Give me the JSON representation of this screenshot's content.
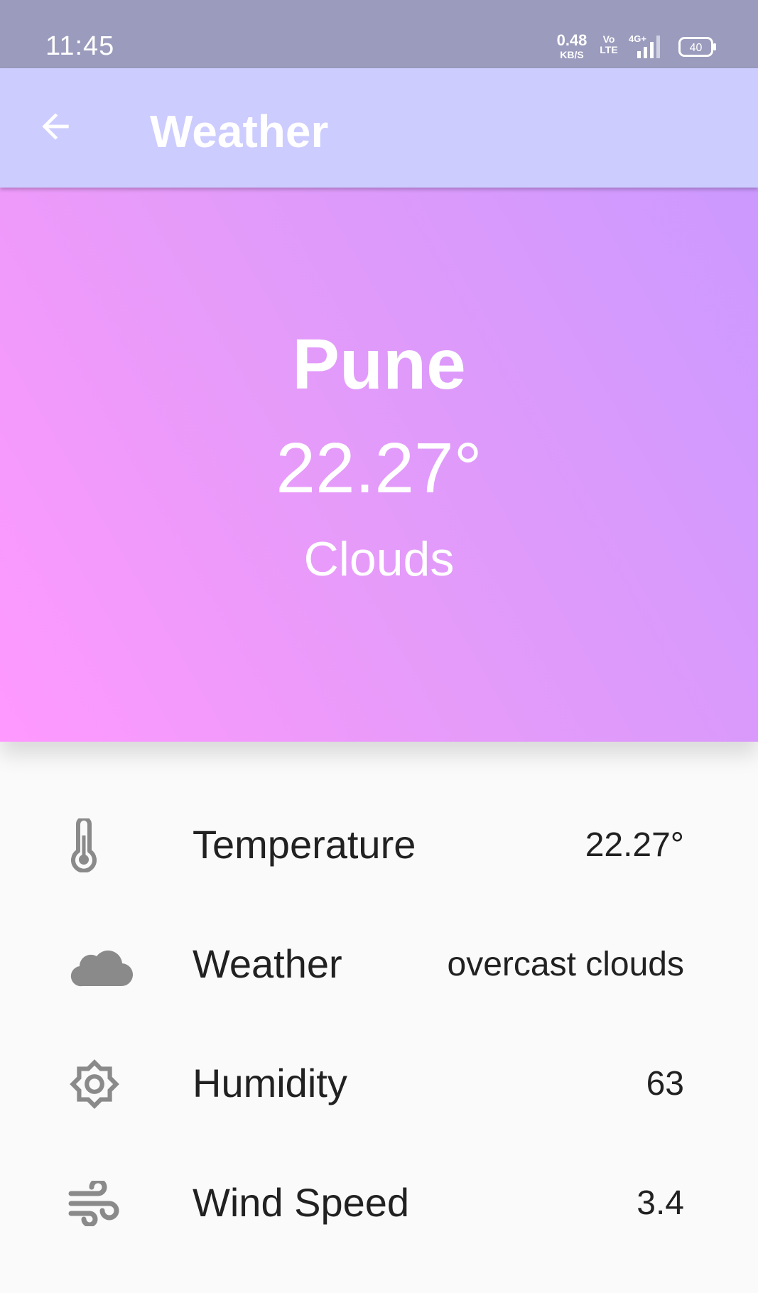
{
  "status_bar": {
    "time": "11:45",
    "net_speed_value": "0.48",
    "net_speed_unit": "KB/S",
    "volte_top": "Vo",
    "volte_bottom": "LTE",
    "network": "4G+",
    "battery": "40"
  },
  "app_bar": {
    "title": "Weather",
    "back_icon": "arrow-left-icon"
  },
  "hero": {
    "city": "Pune",
    "temperature": "22.27°",
    "condition": "Clouds"
  },
  "details": [
    {
      "icon": "thermometer-icon",
      "label": "Temperature",
      "value": "22.27°"
    },
    {
      "icon": "cloud-icon",
      "label": "Weather",
      "value": "overcast clouds"
    },
    {
      "icon": "sun-icon",
      "label": "Humidity",
      "value": "63"
    },
    {
      "icon": "wind-icon",
      "label": "Wind Speed",
      "value": "3.4"
    }
  ],
  "colors": {
    "status_bar": "#9a9bbd",
    "app_bar": "#ccccff",
    "hero_start": "#ff99ff",
    "hero_end": "#cc99ff",
    "icon_gray": "#8a8a8a",
    "text_dark": "#212121"
  }
}
